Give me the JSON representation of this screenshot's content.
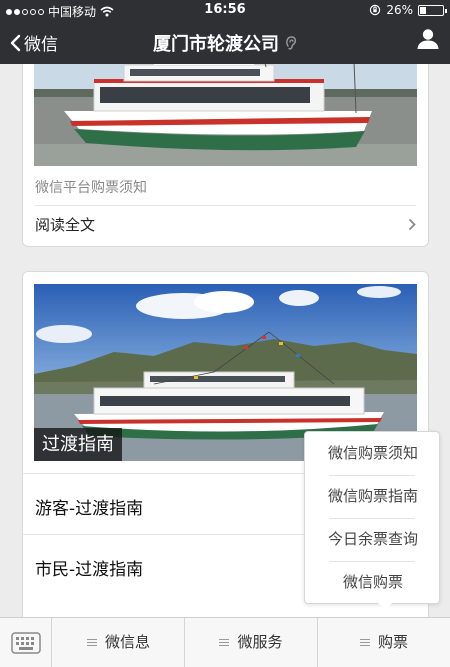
{
  "status_bar": {
    "carrier": "中国移动",
    "time": "16:56",
    "battery_text": "26%",
    "battery_level": 0.26
  },
  "nav": {
    "back_label": "微信",
    "title": "厦门市轮渡公司"
  },
  "card1": {
    "description": "微信平台购票须知",
    "read_more": "阅读全文"
  },
  "card2": {
    "caption": "过渡指南",
    "items": [
      "游客-过渡指南",
      "市民-过渡指南"
    ]
  },
  "popup_menu": {
    "items": [
      "微信购票须知",
      "微信购票指南",
      "今日余票查询",
      "微信购票"
    ]
  },
  "bottom_menu": {
    "items": [
      "微信息",
      "微服务",
      "购票"
    ]
  },
  "colors": {
    "header_bg": "#2e3033",
    "page_bg": "#ececec"
  },
  "icons": [
    "signal-dots-icon",
    "wifi-icon",
    "rotation-lock-icon",
    "battery-icon",
    "back-chevron-icon",
    "ear-icon",
    "user-icon",
    "chevron-right-icon",
    "keyboard-icon",
    "menu-lines-icon"
  ]
}
